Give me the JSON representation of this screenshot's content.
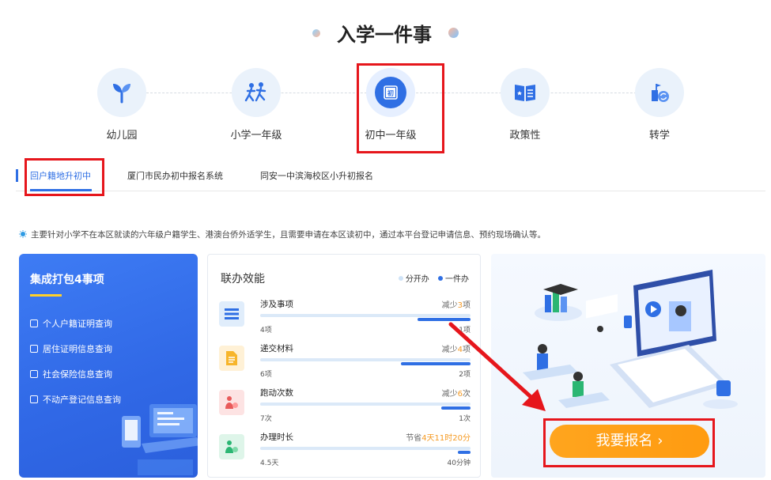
{
  "page_title": "入学一件事",
  "categories": [
    {
      "label": "幼儿园",
      "icon": "sprout-icon"
    },
    {
      "label": "小学一年级",
      "icon": "children-running-icon"
    },
    {
      "label": "初中一年级",
      "icon": "junior-school-book-icon",
      "icon_text": "初"
    },
    {
      "label": "政策性",
      "icon": "policy-book-icon"
    },
    {
      "label": "转学",
      "icon": "transfer-icon"
    }
  ],
  "active_category": "初中一年级",
  "tabs": [
    {
      "label": "回户籍地升初中"
    },
    {
      "label": "厦门市民办初中报名系统"
    },
    {
      "label": "同安一中滨海校区小升初报名"
    }
  ],
  "notice": "主要针对小学不在本区就读的六年级户籍学生、港澳台侨外适学生，且需要申请在本区读初中，通过本平台登记申请信息、预约现场确认等。",
  "package": {
    "title": "集成打包4事项",
    "items": [
      {
        "label": "个人户籍证明查询",
        "icon": "id-card-icon"
      },
      {
        "label": "居住证明信息查询",
        "icon": "residence-card-icon"
      },
      {
        "label": "社会保险信息查询",
        "icon": "insurance-doc-icon"
      },
      {
        "label": "不动产登记信息查询",
        "icon": "property-icon"
      }
    ]
  },
  "efficiency": {
    "title": "联办效能",
    "legend": [
      {
        "label": "分开办",
        "color": "#cfe3f7"
      },
      {
        "label": "一件办",
        "color": "#2f6fe4"
      }
    ],
    "rows": [
      {
        "name": "涉及事项",
        "reduce_prefix": "减少",
        "reduce_value": "3",
        "reduce_suffix": "项",
        "left": "4项",
        "right": "1项",
        "icon": "list-icon",
        "icon_bg": "#e0edfb",
        "ratio": 0.25
      },
      {
        "name": "递交材料",
        "reduce_prefix": "减少",
        "reduce_value": "4",
        "reduce_suffix": "项",
        "left": "6项",
        "right": "2项",
        "icon": "document-icon",
        "icon_bg": "#fff1d6",
        "ratio": 0.33
      },
      {
        "name": "跑动次数",
        "reduce_prefix": "减少",
        "reduce_value": "6",
        "reduce_suffix": "次",
        "left": "7次",
        "right": "1次",
        "icon": "person-walk-icon",
        "icon_bg": "#fde3e3",
        "ratio": 0.14
      },
      {
        "name": "办理时长",
        "reduce_prefix": "节省",
        "reduce_value": "4天11时20分",
        "reduce_suffix": "",
        "left": "4.5天",
        "right": "40分钟",
        "icon": "person-clock-icon",
        "icon_bg": "#def5e9",
        "ratio": 0.06
      }
    ]
  },
  "cta": {
    "label": "我要报名",
    "chevron": "›"
  }
}
